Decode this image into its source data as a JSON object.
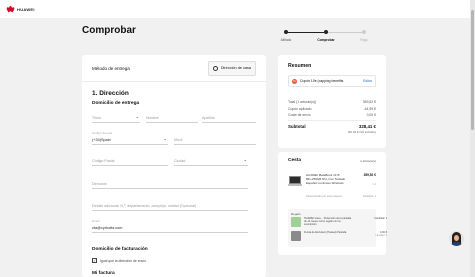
{
  "header": {
    "brand": "HUAWEI"
  },
  "page_title": "Comprobar",
  "steps": [
    {
      "label": "Aliñado",
      "state": "done"
    },
    {
      "label": "Comprobar",
      "state": "active"
    },
    {
      "label": "Pago",
      "state": "todo"
    }
  ],
  "delivery": {
    "method_label": "Método de entrega",
    "store_button": "Dirección de casa"
  },
  "address": {
    "section_title": "1. Dirección",
    "shipping_title": "Domicilio de entrega",
    "title_placeholder": "Título",
    "first_name_placeholder": "Nombre",
    "last_name_placeholder": "Apellido",
    "prefix_label": "Código de país",
    "prefix_value": "(+34)Spain",
    "phone_placeholder": "Móvil",
    "postal_placeholder": "Código Postal",
    "city_placeholder": "Ciudad",
    "address_placeholder": "Dirección",
    "details_placeholder": "Detalle adicional: N.º, departamento, complejo, unidad (Opcional)",
    "email_label": "Email",
    "email_value": "cfa@cyrhotts.com"
  },
  "billing": {
    "title": "Domicilio de facturación",
    "same_label": "Igual que la dirección de envío",
    "checked": true
  },
  "invoice": {
    "title": "Mi factura"
  },
  "summary": {
    "title": "Resumen",
    "coupon_text": "Cupón 10e (capping benefits",
    "coupon_edit": "Editar",
    "rows": [
      {
        "label": "Total (1 artículo(s))",
        "value": "359,52 €"
      },
      {
        "label": "Cupón aplicado",
        "value": "-44,99 €"
      },
      {
        "label": "Coste de envío",
        "value": "0,00 €"
      }
    ],
    "subtotal_label": "Subtotal",
    "subtotal_value": "328,41 €",
    "vat_text": "(52,04 € IVA incluido)"
  },
  "basket": {
    "title": "Cesta",
    "count": "1 artículo(s)",
    "product_name": "HUAWEI MateBook 13 i5 8th+256GB 8/U, Con Teclado Español Luminoso Windows",
    "product_price": "359,52 €",
    "product_sub": "x 1",
    "product_note": "Seleccionado por esta paquete",
    "product_note_right": "Cantidad: 1",
    "gifts_title": "Regalo",
    "gifts": [
      {
        "text": "HUAWEI Care+ · Protección de la pantalla de 12 meses como regalo con su suscripción",
        "price": "Cantidad: 1",
        "sub": ""
      },
      {
        "text": "Funda de Exclusivo (Huawei) Pantalla",
        "price": "0,00 €",
        "sub": "Cantidad: 1"
      }
    ]
  },
  "colors": {
    "accent": "#cf0a2c",
    "step_active": "#222222",
    "step_todo": "#cccccc",
    "link": "#2a6bd1"
  }
}
